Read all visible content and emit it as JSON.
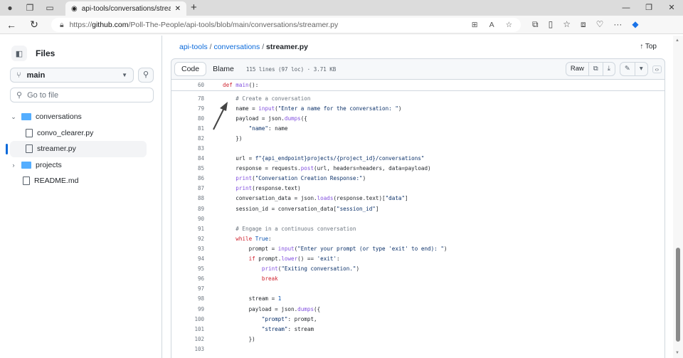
{
  "browser": {
    "tab_title": "api-tools/conversations/streamer.py",
    "url_prefix": "https://",
    "url_host": "github.com",
    "url_path": "/Poll-The-People/api-tools/blob/main/conversations/streamer.py"
  },
  "sidebar": {
    "title": "Files",
    "branch": "main",
    "goto_placeholder": "Go to file",
    "tree": [
      {
        "label": "conversations",
        "type": "folder",
        "open": true
      },
      {
        "label": "convo_clearer.py",
        "type": "file"
      },
      {
        "label": "streamer.py",
        "type": "file",
        "selected": true
      },
      {
        "label": "projects",
        "type": "folder",
        "open": false
      },
      {
        "label": "README.md",
        "type": "file"
      }
    ]
  },
  "breadcrumb": {
    "repo": "api-tools",
    "folder": "conversations",
    "file": "streamer.py",
    "sep": "/"
  },
  "top_label": "↑ Top",
  "file_header": {
    "code_tab": "Code",
    "blame_tab": "Blame",
    "meta": "115 lines (97 loc) · 3.71 KB",
    "raw": "Raw"
  },
  "sticky": {
    "n": "60",
    "tokens": [
      [
        "def ",
        "k"
      ],
      [
        "main",
        "f"
      ],
      [
        "():",
        ""
      ]
    ]
  },
  "lines": [
    {
      "n": "78",
      "tokens": [
        [
          "    # Create a conversation",
          "c"
        ]
      ]
    },
    {
      "n": "79",
      "tokens": [
        [
          "    name = ",
          ""
        ],
        [
          "input",
          "f"
        ],
        [
          "(",
          ""
        ],
        [
          "\"Enter a name for the conversation: \"",
          "s"
        ],
        [
          ")",
          ""
        ]
      ]
    },
    {
      "n": "80",
      "tokens": [
        [
          "    payload = json.",
          ""
        ],
        [
          "dumps",
          "f"
        ],
        [
          "({",
          ""
        ]
      ]
    },
    {
      "n": "81",
      "tokens": [
        [
          "        \"name\"",
          "s"
        ],
        [
          ": name",
          ""
        ]
      ]
    },
    {
      "n": "82",
      "tokens": [
        [
          "    })",
          ""
        ]
      ]
    },
    {
      "n": "83",
      "tokens": []
    },
    {
      "n": "84",
      "tokens": [
        [
          "    url = ",
          ""
        ],
        [
          "f\"{api_endpoint}projects/{project_id}/conversations\"",
          "s"
        ]
      ]
    },
    {
      "n": "85",
      "tokens": [
        [
          "    response = requests.",
          ""
        ],
        [
          "post",
          "f"
        ],
        [
          "(url, headers=headers, data=payload)",
          ""
        ]
      ]
    },
    {
      "n": "86",
      "tokens": [
        [
          "    ",
          ""
        ],
        [
          "print",
          "f"
        ],
        [
          "(",
          ""
        ],
        [
          "\"Conversation Creation Response:\"",
          "s"
        ],
        [
          ")",
          ""
        ]
      ]
    },
    {
      "n": "87",
      "tokens": [
        [
          "    ",
          ""
        ],
        [
          "print",
          "f"
        ],
        [
          "(response.text)",
          ""
        ]
      ]
    },
    {
      "n": "88",
      "tokens": [
        [
          "    conversation_data = json.",
          ""
        ],
        [
          "loads",
          "f"
        ],
        [
          "(response.text)[",
          ""
        ],
        [
          "\"data\"",
          "s"
        ],
        [
          "]",
          ""
        ]
      ]
    },
    {
      "n": "89",
      "tokens": [
        [
          "    session_id = conversation_data[",
          ""
        ],
        [
          "\"session_id\"",
          "s"
        ],
        [
          "]",
          ""
        ]
      ]
    },
    {
      "n": "90",
      "tokens": []
    },
    {
      "n": "91",
      "tokens": [
        [
          "    # Engage in a continuous conversation",
          "c"
        ]
      ]
    },
    {
      "n": "92",
      "tokens": [
        [
          "    ",
          ""
        ],
        [
          "while ",
          "k"
        ],
        [
          "True",
          "n"
        ],
        [
          ":",
          ""
        ]
      ]
    },
    {
      "n": "93",
      "tokens": [
        [
          "        prompt = ",
          ""
        ],
        [
          "input",
          "f"
        ],
        [
          "(",
          ""
        ],
        [
          "\"Enter your prompt (or type 'exit' to end): \"",
          "s"
        ],
        [
          ")",
          ""
        ]
      ]
    },
    {
      "n": "94",
      "tokens": [
        [
          "        ",
          ""
        ],
        [
          "if ",
          "k"
        ],
        [
          "prompt.",
          ""
        ],
        [
          "lower",
          "f"
        ],
        [
          "() == ",
          ""
        ],
        [
          "'exit'",
          "s"
        ],
        [
          ":",
          ""
        ]
      ]
    },
    {
      "n": "95",
      "tokens": [
        [
          "            ",
          ""
        ],
        [
          "print",
          "f"
        ],
        [
          "(",
          ""
        ],
        [
          "\"Exiting conversation.\"",
          "s"
        ],
        [
          ")",
          ""
        ]
      ]
    },
    {
      "n": "96",
      "tokens": [
        [
          "            ",
          ""
        ],
        [
          "break",
          "k"
        ]
      ]
    },
    {
      "n": "97",
      "tokens": []
    },
    {
      "n": "98",
      "tokens": [
        [
          "        stream = ",
          ""
        ],
        [
          "1",
          "n"
        ]
      ]
    },
    {
      "n": "99",
      "tokens": [
        [
          "        payload = json.",
          ""
        ],
        [
          "dumps",
          "f"
        ],
        [
          "({",
          ""
        ]
      ]
    },
    {
      "n": "100",
      "tokens": [
        [
          "            \"prompt\"",
          "s"
        ],
        [
          ": prompt,",
          ""
        ]
      ]
    },
    {
      "n": "101",
      "tokens": [
        [
          "            \"stream\"",
          "s"
        ],
        [
          ": stream",
          ""
        ]
      ]
    },
    {
      "n": "102",
      "tokens": [
        [
          "        })",
          ""
        ]
      ]
    },
    {
      "n": "103",
      "tokens": []
    }
  ]
}
